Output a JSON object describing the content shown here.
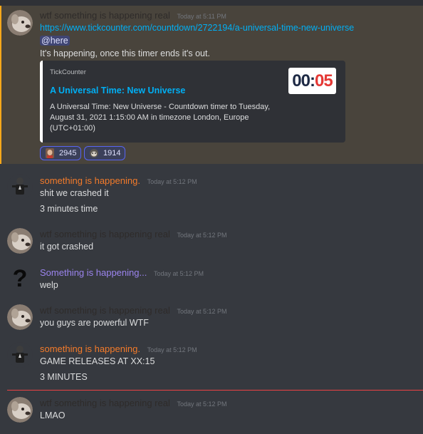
{
  "messages": [
    {
      "author": "wtf something is happening real",
      "author_color": "#2e2b2a",
      "timestamp": "Today at 5:11 PM",
      "link": "https://www.tickcounter.com/countdown/2722194/a-universal-time-new-universe",
      "mention": "@here",
      "text": "It's happening, once this timer ends it's out.",
      "embed": {
        "provider": "TickCounter",
        "title": "A Universal Time: New Universe",
        "description": "A Universal Time: New Universe - Countdown timer to Tuesday, August 31, 2021 1:15:00 AM in timezone London, Europe (UTC+01:00)",
        "thumb_left": "00:",
        "thumb_right": "05"
      },
      "reactions": [
        {
          "emoji": "portrait-emoji",
          "count": "2945"
        },
        {
          "emoji": "cat-emoji",
          "count": "1914"
        }
      ]
    },
    {
      "author": "something is happening.",
      "author_color": "#f47b2a",
      "timestamp": "Today at 5:12 PM",
      "lines": [
        "shit we crashed it",
        "3 minutes time"
      ]
    },
    {
      "author": "wtf something is happening real",
      "author_color": "#2e2b2a",
      "timestamp": "Today at 5:12 PM",
      "lines": [
        "it got crashed"
      ]
    },
    {
      "author": "Something is happening...",
      "author_color": "#9b84ee",
      "timestamp": "Today at 5:12 PM",
      "avatar_glyph": "?",
      "lines": [
        "welp"
      ]
    },
    {
      "author": "wtf something is happening real",
      "author_color": "#2e2b2a",
      "timestamp": "Today at 5:12 PM",
      "lines": [
        "you guys are powerful WTF"
      ]
    },
    {
      "author": "something is happening.",
      "author_color": "#f47b2a",
      "timestamp": "Today at 5:12 PM",
      "lines": [
        "GAME RELEASES AT XX:15",
        "3 MINUTES"
      ]
    },
    {
      "author": "wtf something is happening real",
      "author_color": "#2e2b2a",
      "timestamp": "Today at 5:12 PM",
      "lines": [
        "LMAO"
      ]
    }
  ]
}
